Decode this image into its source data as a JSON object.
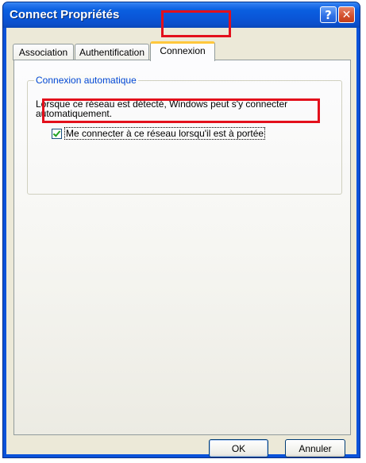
{
  "window": {
    "title": "Connect Propriétés",
    "help_glyph": "?",
    "close_glyph": "✕"
  },
  "tabs": [
    {
      "label": "Association",
      "selected": false
    },
    {
      "label": "Authentification",
      "selected": false
    },
    {
      "label": "Connexion",
      "selected": true
    }
  ],
  "group": {
    "legend": "Connexion automatique",
    "description": "Lorsque ce réseau est détecté, Windows peut s'y connecter automatiquement.",
    "checkbox": {
      "label": "Me connecter à ce réseau lorsqu'il est à portée",
      "checked": true
    }
  },
  "buttons": {
    "ok": "OK",
    "cancel": "Annuler"
  },
  "colors": {
    "titlebar": "#0a56d8",
    "highlight": "#e3101c",
    "groupbox_legend": "#0046d5"
  }
}
